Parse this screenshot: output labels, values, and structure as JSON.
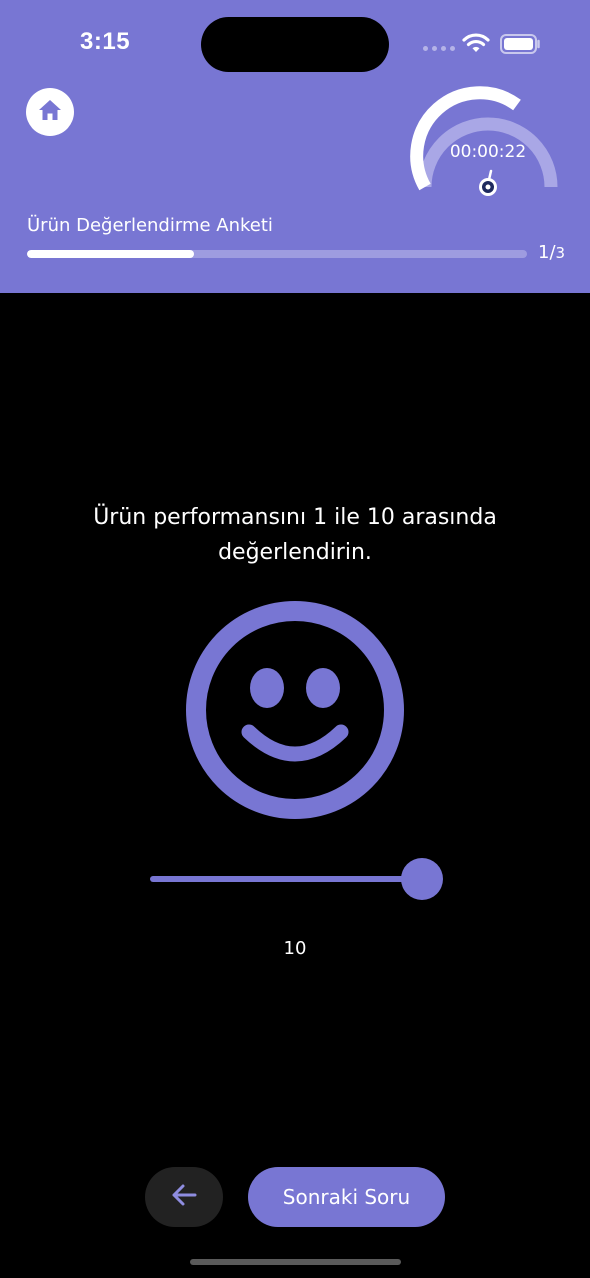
{
  "status_bar": {
    "time": "3:15"
  },
  "header": {
    "home_icon": "home-icon",
    "timer": {
      "elapsed": "00:00:22",
      "icon": "stopwatch-icon"
    },
    "survey_title": "Ürün Değerlendirme Anketi",
    "progress": {
      "current": "1",
      "separator": "/",
      "total": "3",
      "fraction": 0.333
    }
  },
  "question": {
    "text": "Ürün performansını 1 ile 10 arasında değerlendirin.",
    "emoji_icon": "smiley-face-icon"
  },
  "slider": {
    "min": 1,
    "max": 10,
    "value": 10,
    "value_label": "10"
  },
  "footer": {
    "back_icon": "arrow-left-icon",
    "next_label": "Sonraki Soru"
  },
  "colors": {
    "accent": "#7876D3",
    "accent_light": "#9E9CE0",
    "background": "#000000",
    "back_button": "#222222"
  }
}
